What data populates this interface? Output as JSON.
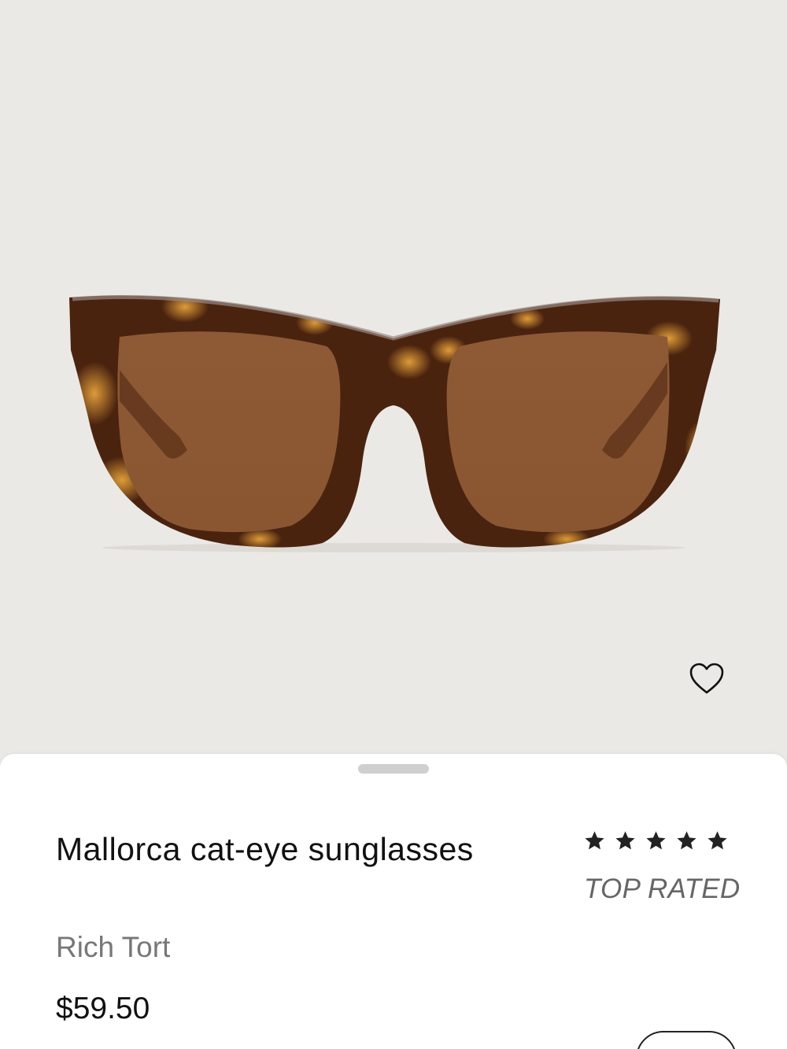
{
  "product": {
    "name": "Mallorca cat-eye sunglasses",
    "color": "Rich Tort",
    "price": "$59.50",
    "rating_stars": 5,
    "rating_label": "TOP RATED",
    "image_alt": "Mallorca cat-eye sunglasses in Rich Tort tortoiseshell with brown lenses"
  },
  "icons": {
    "wishlist": "heart-icon",
    "rating": "star-icon"
  },
  "colors": {
    "background": "#ebe9e5",
    "frame": "#4a230f",
    "lens": "#8a5530",
    "text_primary": "#111111",
    "text_secondary": "#777777"
  }
}
